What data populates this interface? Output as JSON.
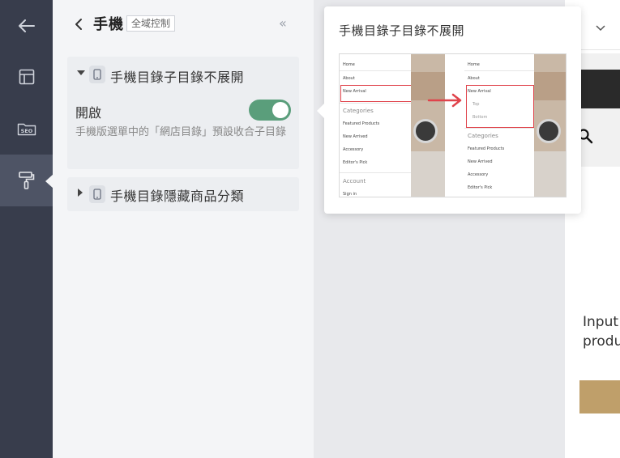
{
  "rail": {
    "items": [
      {
        "icon": "arrow-left-icon"
      },
      {
        "icon": "layout-icon"
      },
      {
        "icon": "seo-icon",
        "label": "SEO"
      },
      {
        "icon": "paint-roller-icon",
        "active": true
      }
    ]
  },
  "panel": {
    "title": "手機",
    "badge": "全域控制",
    "collapse_symbol": "«",
    "sections": [
      {
        "title": "手機目錄子目錄不展開",
        "expanded": true,
        "toggle_label": "開啟",
        "toggle_on": true,
        "description": "手機版選單中的「網店目錄」預設收合子目錄"
      },
      {
        "title": "手機目錄隱藏商品分類",
        "expanded": false
      }
    ]
  },
  "popover": {
    "title": "手機目錄子目錄不展開",
    "illustration": {
      "left_menu": {
        "items": [
          "Home",
          "About",
          "New Arrival"
        ],
        "categories_header": "Categories",
        "category_items": [
          "Featured Products",
          "New Arrived",
          "Accessory",
          "Editor's Pick"
        ],
        "account_header": "Account",
        "account_items": [
          "Sign in"
        ]
      },
      "right_menu": {
        "items": [
          "Home",
          "About",
          "New Arrival"
        ],
        "sub_items": [
          "Top",
          "Bottom"
        ],
        "categories_header": "Categories",
        "category_items": [
          "Featured Products",
          "New Arrived",
          "Accessory",
          "Editor's Pick"
        ]
      },
      "highlight_color": "#e0434b"
    }
  },
  "preview": {
    "text_lines": [
      "Input",
      "produ"
    ],
    "button_color": "#bf9f6a",
    "toggle_color": "#5a9e7b"
  }
}
